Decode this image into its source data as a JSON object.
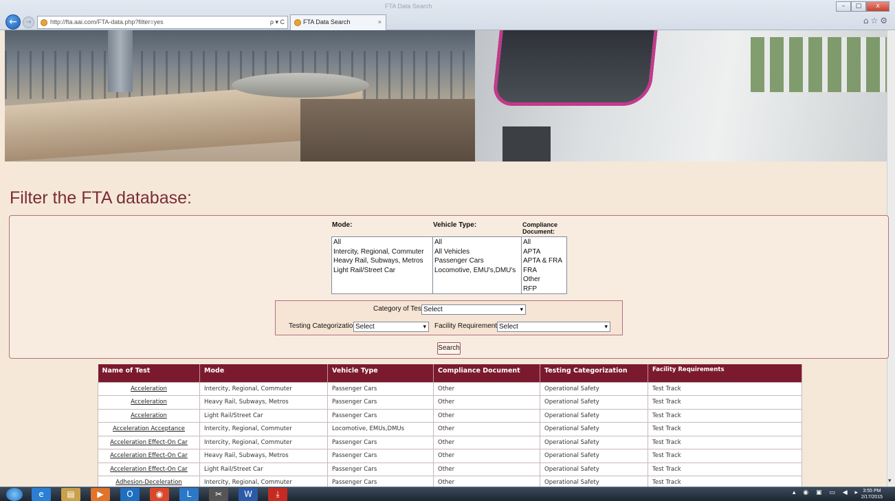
{
  "browser": {
    "window_title": "FTA Data Search",
    "url": "http://fta.aai.com/FTA-data.php?filter=yes",
    "tab_title": "FTA Data Search",
    "address_tools": "ρ ▾ C",
    "tab_close": "×",
    "min": "–",
    "max": "□",
    "close": "x",
    "back": "←",
    "forward": "→",
    "right_icons": "⌂☆⚙"
  },
  "page": {
    "heading": "Filter the FTA database:"
  },
  "filters": {
    "mode": {
      "label": "Mode:",
      "options": [
        "All",
        "Intercity, Regional, Commuter",
        "Heavy Rail, Subways, Metros",
        "Light Rail/Street Car"
      ]
    },
    "vehicle_type": {
      "label": "Vehicle Type:",
      "options": [
        "All",
        "All Vehicles",
        "Passenger Cars",
        "Locomotive, EMU's,DMU's"
      ]
    },
    "compliance": {
      "label": "Compliance Document:",
      "options": [
        "All",
        "APTA",
        "APTA & FRA",
        "FRA",
        "Other",
        "RFP"
      ]
    },
    "category_of_test": {
      "label": "Category of Test:",
      "value": "Select"
    },
    "testing_categorization": {
      "label": "Testing Categorization:",
      "value": "Select"
    },
    "facility_requirements": {
      "label": "Facility Requirements:",
      "value": "Select"
    },
    "search_label": "Search",
    "caret": "▾"
  },
  "table": {
    "headers": [
      "Name of Test",
      "Mode",
      "Vehicle Type",
      "Compliance Document",
      "Testing Categorization",
      "Facility Requirements"
    ],
    "rows": [
      [
        "Acceleration",
        "Intercity, Regional, Commuter",
        "Passenger Cars",
        "Other",
        "Operational Safety",
        "Test Track"
      ],
      [
        "Acceleration",
        "Heavy Rail, Subways, Metros",
        "Passenger Cars",
        "Other",
        "Operational Safety",
        "Test Track"
      ],
      [
        "Acceleration",
        "Light Rail/Street Car",
        "Passenger Cars",
        "Other",
        "Operational Safety",
        "Test Track"
      ],
      [
        "Acceleration Acceptance",
        "Intercity, Regional, Commuter",
        "Locomotive, EMUs,DMUs",
        "Other",
        "Operational Safety",
        "Test Track"
      ],
      [
        "Acceleration Effect-On Car",
        "Intercity, Regional, Commuter",
        "Passenger Cars",
        "Other",
        "Operational Safety",
        "Test Track"
      ],
      [
        "Acceleration Effect-On Car",
        "Heavy Rail, Subways, Metros",
        "Passenger Cars",
        "Other",
        "Operational Safety",
        "Test Track"
      ],
      [
        "Acceleration Effect-On Car",
        "Light Rail/Street Car",
        "Passenger Cars",
        "Other",
        "Operational Safety",
        "Test Track"
      ],
      [
        "Adhesion-Deceleration",
        "Intercity, Regional, Commuter",
        "Passenger Cars",
        "Other",
        "Operational Safety",
        "Test Track"
      ]
    ]
  },
  "taskbar": {
    "apps": [
      "ie-icon",
      "explorer-icon",
      "media-icon",
      "outlook-icon",
      "chrome-icon",
      "lync-icon",
      "snipping-icon",
      "word-icon",
      "acrobat-icon"
    ],
    "app_glyphs": [
      "e",
      "▤",
      "▶",
      "O",
      "◉",
      "L",
      "✂",
      "W",
      "⤓"
    ],
    "tray": "▴ ◉ ▣ ▭ ◀ ▸",
    "time": "3:55 PM",
    "date": "2/17/2015"
  },
  "colors": {
    "accent": "#7b1a2e",
    "heading": "#7a2c3a",
    "page_bg": "#f5e8d8"
  }
}
